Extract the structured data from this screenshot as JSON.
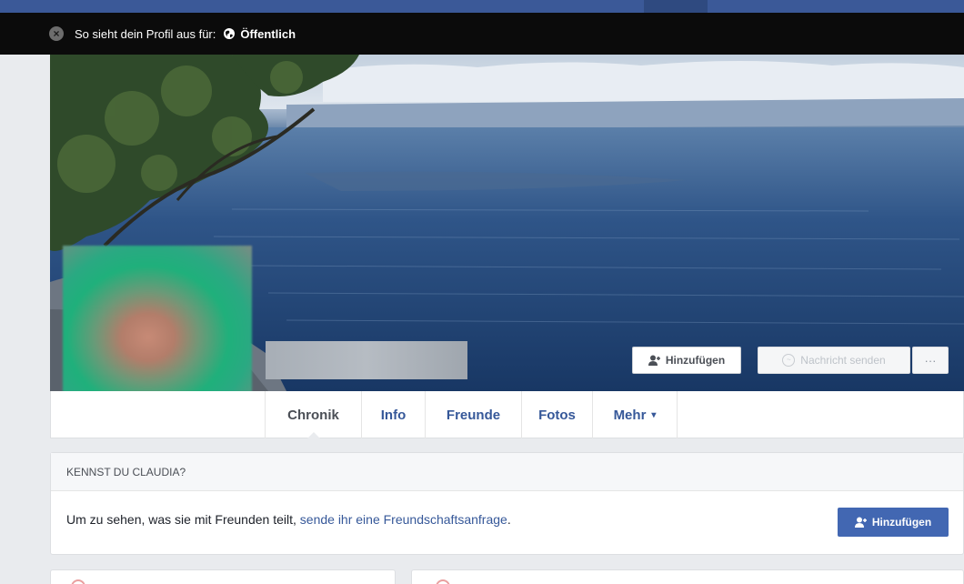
{
  "view_bar": {
    "close_icon": "close-circle-icon",
    "label": "So sieht dein Profil aus für:",
    "audience_icon": "globe-icon",
    "audience": "Öffentlich"
  },
  "profile": {
    "cover_actions": {
      "add_friend": "Hinzufügen",
      "message": "Nachricht senden",
      "more": "···"
    },
    "tabs": [
      {
        "label": "Chronik",
        "active": true
      },
      {
        "label": "Info"
      },
      {
        "label": "Freunde"
      },
      {
        "label": "Fotos"
      },
      {
        "label": "Mehr",
        "caret": "▾"
      }
    ]
  },
  "know_card": {
    "title": "KENNST DU CLAUDIA?",
    "text": "Um zu sehen, was sie mit Freunden teilt, ",
    "link": "sende ihr eine Freundschaftsanfrage",
    "suffix": ".",
    "button": "Hinzufügen"
  },
  "colors": {
    "brand": "#3b5998",
    "button_blue": "#4267b2",
    "link": "#365899",
    "page_bg": "#e9ebee"
  }
}
